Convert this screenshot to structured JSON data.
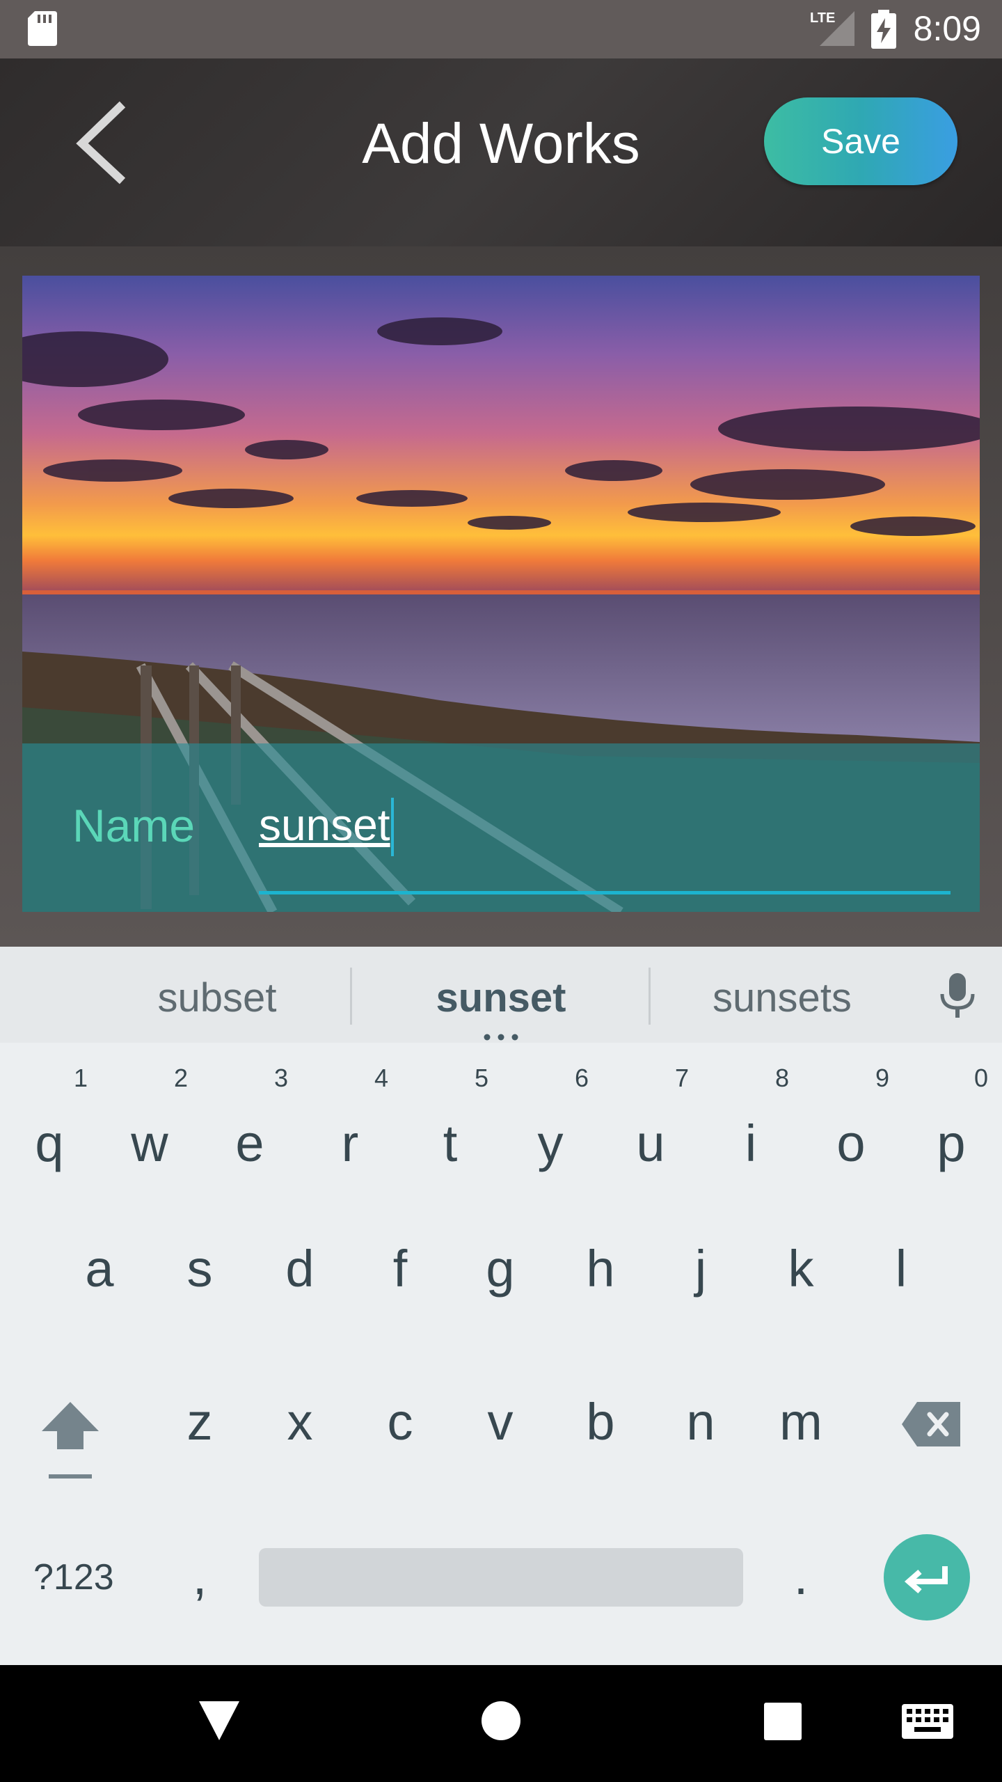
{
  "status_bar": {
    "time": "8:09",
    "network": "LTE"
  },
  "header": {
    "title": "Add Works",
    "save_label": "Save"
  },
  "form": {
    "name_label": "Name",
    "name_value": "sunset"
  },
  "keyboard": {
    "suggestions": [
      "subset",
      "sunset",
      "sunsets"
    ],
    "row1": [
      "q",
      "w",
      "e",
      "r",
      "t",
      "y",
      "u",
      "i",
      "o",
      "p"
    ],
    "row1_hints": [
      "1",
      "2",
      "3",
      "4",
      "5",
      "6",
      "7",
      "8",
      "9",
      "0"
    ],
    "row2": [
      "a",
      "s",
      "d",
      "f",
      "g",
      "h",
      "j",
      "k",
      "l"
    ],
    "row3": [
      "z",
      "x",
      "c",
      "v",
      "b",
      "n",
      "m"
    ],
    "symbols_label": "?123",
    "comma": ",",
    "period": "."
  },
  "colors": {
    "accent": "#3dbda3",
    "save_gradient_end": "#3a9ee2",
    "input_underline": "#1cb4cf"
  }
}
